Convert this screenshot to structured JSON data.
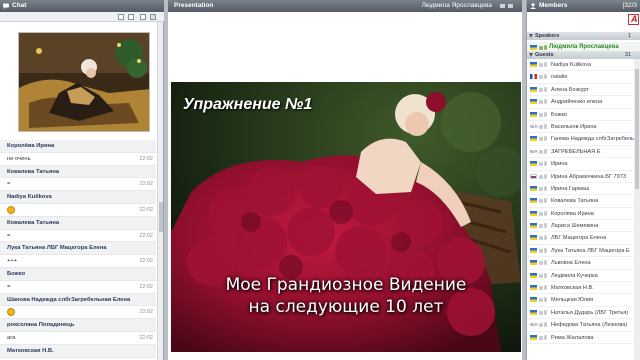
{
  "chat": {
    "title": "Chat",
    "messages": [
      {
        "type": "author",
        "text": "Королёва Ирина",
        "time": ""
      },
      {
        "type": "text",
        "text": "не очень",
        "time": "22:02"
      },
      {
        "type": "author",
        "text": "Ковалева Татьяна",
        "time": ""
      },
      {
        "type": "text",
        "text": "=",
        "time": "22:02"
      },
      {
        "type": "author",
        "text": "Nadiya Kulikova",
        "time": ""
      },
      {
        "type": "smiley",
        "text": "",
        "time": "22:02"
      },
      {
        "type": "author",
        "text": "Ковалева Татьяна",
        "time": ""
      },
      {
        "type": "text",
        "text": "=",
        "time": "22:02"
      },
      {
        "type": "author",
        "text": "Лука Татьяна ЛБГ Мацегора Елена",
        "time": ""
      },
      {
        "type": "text",
        "text": "+++",
        "time": "22:02"
      },
      {
        "type": "author",
        "text": "Божко",
        "time": ""
      },
      {
        "type": "text",
        "text": "=",
        "time": "22:02"
      },
      {
        "type": "author",
        "text": "Шанова Надежда слбгЗагребельная Елена",
        "time": ""
      },
      {
        "type": "smiley",
        "text": "",
        "time": "22:02"
      },
      {
        "type": "author",
        "text": "роксолана Попадинець",
        "time": ""
      },
      {
        "type": "text",
        "text": "ага",
        "time": "22:02"
      },
      {
        "type": "author",
        "text": "Матковская Н.В.",
        "time": ""
      }
    ]
  },
  "presentation": {
    "title": "Presentation",
    "presenter": "Людмила Ярославцева",
    "slide_title": "Упражнение №1",
    "slide_caption_line1": "Мое Грандиозное Видение",
    "slide_caption_line2": "на следующие 10 лет"
  },
  "members": {
    "title": "Members",
    "count": "[32/3",
    "speakers_label": "Speakers",
    "speakers_count": "1",
    "speaker_name": "Людмила Ярославцева",
    "guests_label": "Guests",
    "guests_count": "31",
    "guests": [
      {
        "flag": "ua",
        "name": "Nadiya Kulikova"
      },
      {
        "flag": "fr",
        "name": "natalie"
      },
      {
        "flag": "ua",
        "name": "Алена Бозкурт"
      },
      {
        "flag": "ua",
        "name": "Андрийченко елена"
      },
      {
        "flag": "ua",
        "name": "Божко"
      },
      {
        "flag": "na",
        "name": "Васильков Ирина"
      },
      {
        "flag": "ua",
        "name": "Ганова Надежда слбгЗагребельная"
      },
      {
        "flag": "na",
        "name": "ЗАГРЕБЕЛЬНАЯ Е"
      },
      {
        "flag": "ua",
        "name": "Ирина"
      },
      {
        "flag": "ru",
        "name": "Ирина Абрамочкина БГ 7973"
      },
      {
        "flag": "ua",
        "name": "Ирина Гармаш"
      },
      {
        "flag": "ua",
        "name": "Ковалева Татьяна"
      },
      {
        "flag": "ua",
        "name": "Королёва Ирина"
      },
      {
        "flag": "ua",
        "name": "Лариса Шемякина"
      },
      {
        "flag": "ua",
        "name": "ЛБГ Мацегора Елена"
      },
      {
        "flag": "ua",
        "name": "Лука Татьяна ЛБГ Мацегора Е"
      },
      {
        "flag": "ua",
        "name": "Львовна Елена"
      },
      {
        "flag": "ua",
        "name": "Людмила Кучерка"
      },
      {
        "flag": "ua",
        "name": "Матковская Н.В."
      },
      {
        "flag": "ua",
        "name": "Мельцкая Юлия"
      },
      {
        "flag": "ua",
        "name": "Наталья Дударь (ЛБГ Третья)"
      },
      {
        "flag": "na",
        "name": "Нефедова Татьяна (Лезнова)"
      },
      {
        "flag": "ua",
        "name": "Рима Жалалова"
      }
    ]
  },
  "colors": {
    "header": "#5d646d",
    "speaker_green": "#2e8b2e",
    "dress_red": "#9a1030"
  }
}
